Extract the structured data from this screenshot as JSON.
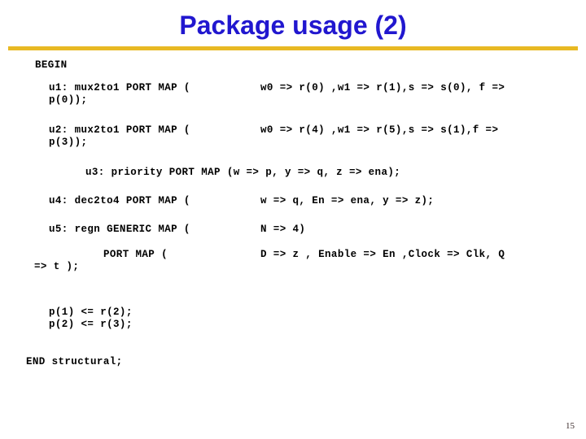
{
  "slide": {
    "title": "Package usage (2)",
    "title_color": "#2117cf",
    "rule_color": "#e8b923",
    "page_number": "15"
  },
  "code": {
    "begin": "BEGIN",
    "end": "END structural;",
    "statements": [
      {
        "id": "u1",
        "left": "u1: mux2to1 PORT MAP (",
        "right": "w0 => r(0) ,w1 => r(1),s => s(0), f =>",
        "continuation": "p(0));"
      },
      {
        "id": "u2",
        "left": "u2: mux2to1 PORT MAP (",
        "right": "w0 => r(4) ,w1 => r(5),s => s(1),f =>",
        "continuation": "p(3));"
      },
      {
        "id": "u3",
        "left": "u3: priority PORT MAP (w => p, y => q, z => ena);",
        "right": "",
        "continuation": ""
      },
      {
        "id": "u4",
        "left": "u4: dec2to4 PORT MAP (",
        "right": "w => q, En => ena, y => z);",
        "continuation": ""
      },
      {
        "id": "u5",
        "left": "u5: regn GENERIC MAP (",
        "right": "N => 4)",
        "continuation": ""
      },
      {
        "id": "u5-port",
        "left": "PORT MAP (",
        "right": "D => z , Enable => En ,Clock => Clk, Q",
        "continuation": "=> t );"
      }
    ],
    "assignments": [
      "p(1) <= r(2);",
      "p(2) <= r(3);"
    ]
  }
}
